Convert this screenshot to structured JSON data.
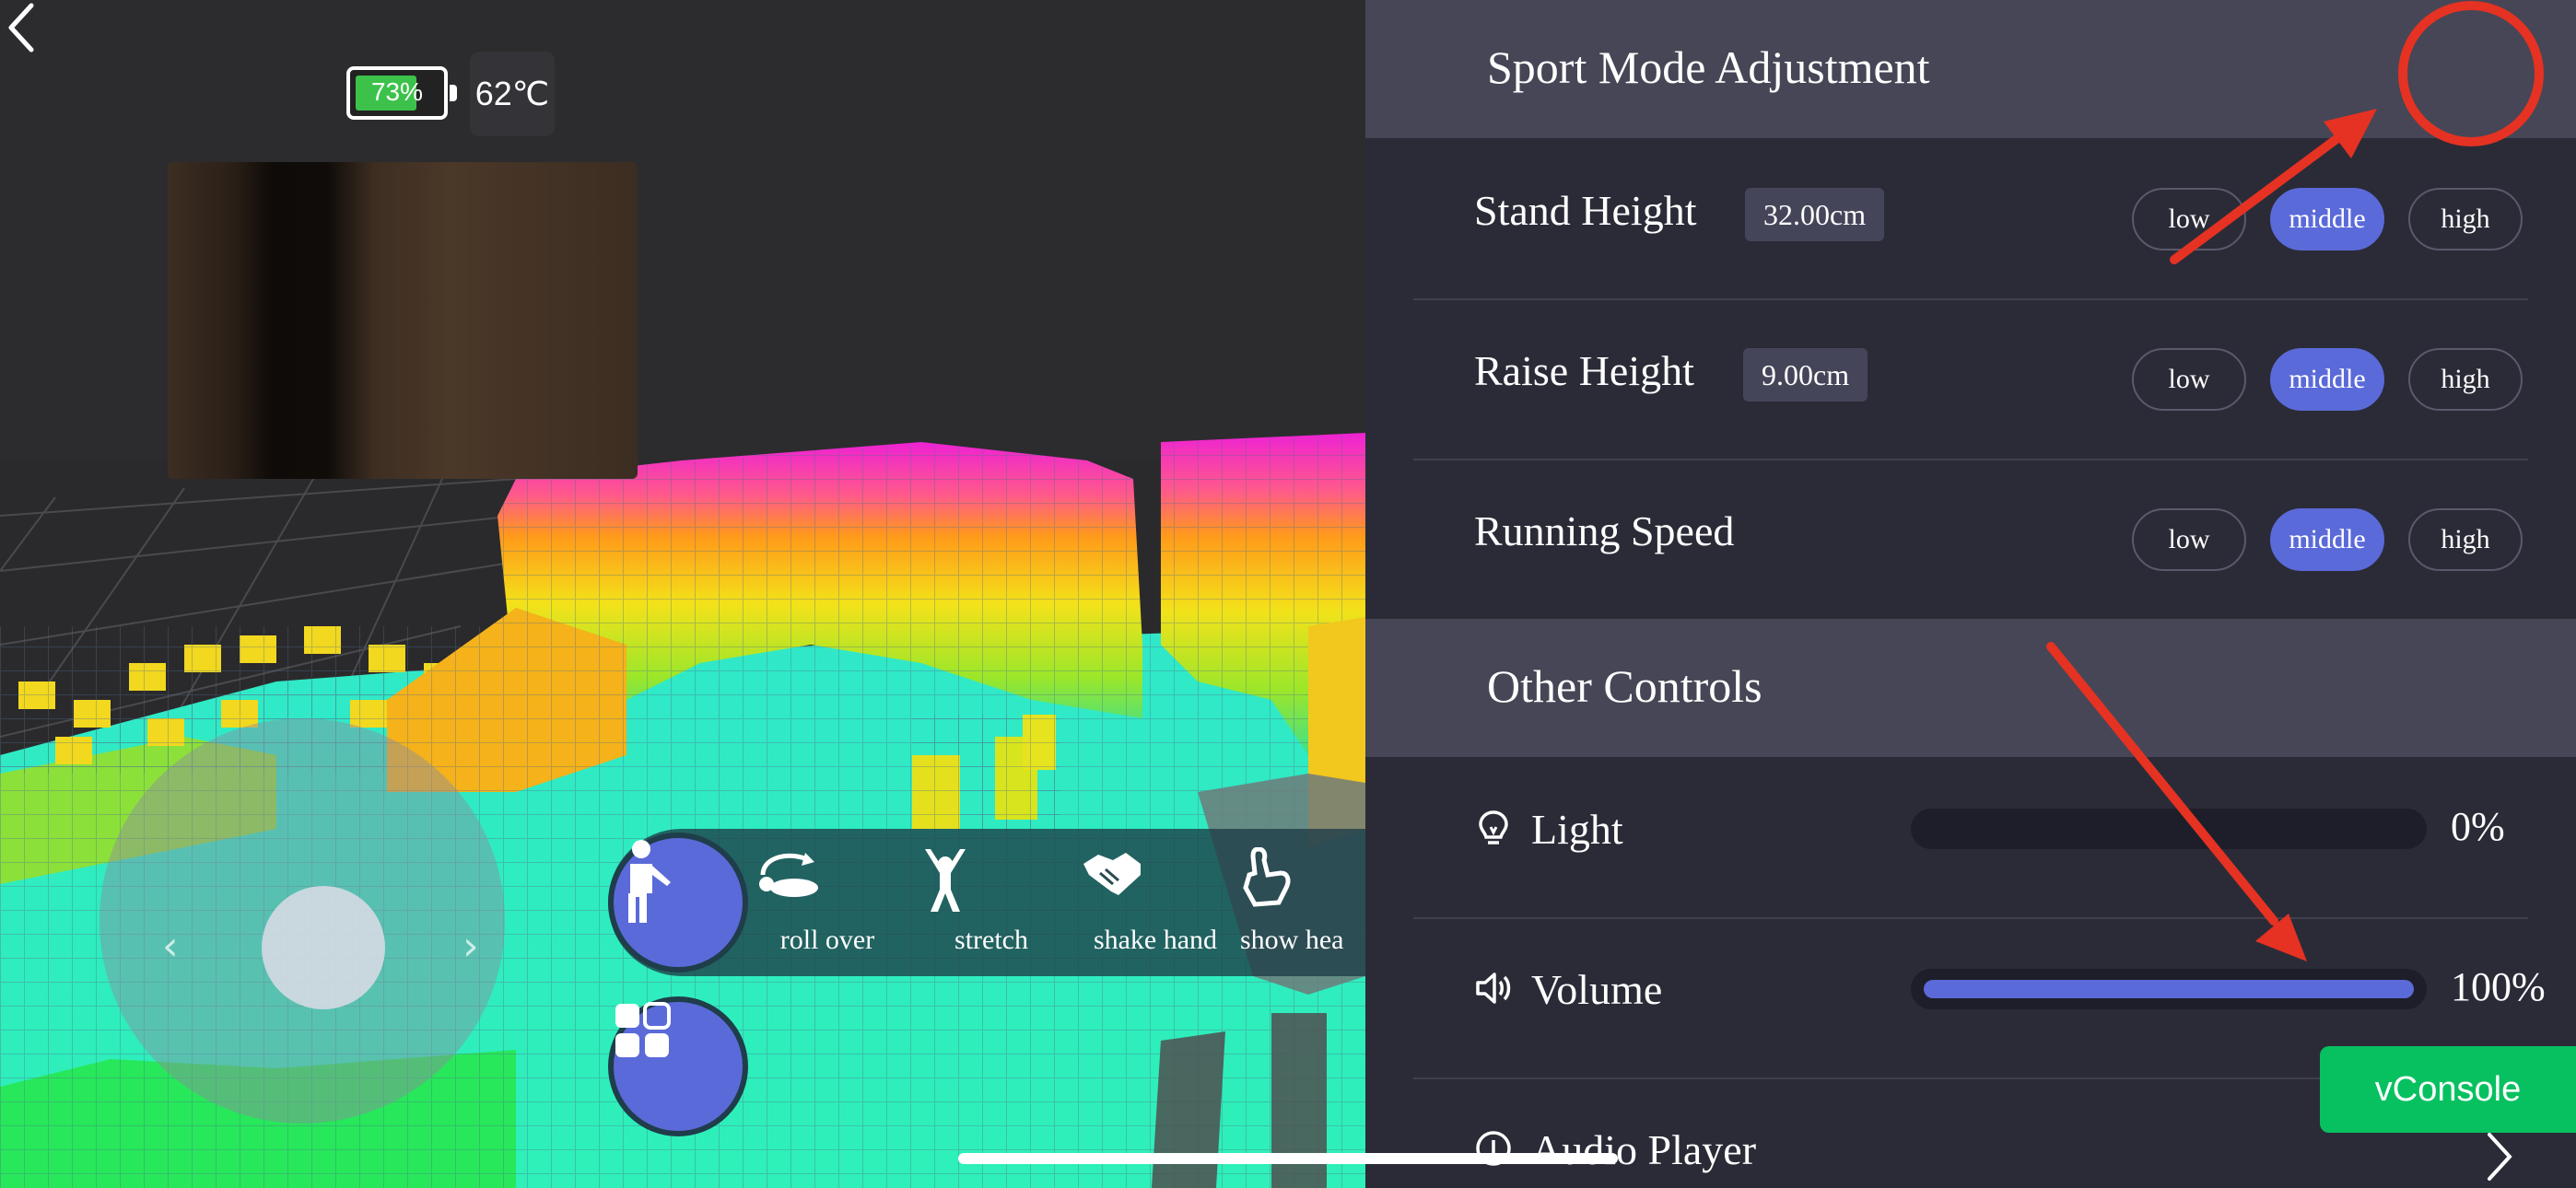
{
  "status": {
    "battery_percent": 73,
    "battery_label": "73%",
    "temperature": "62℃"
  },
  "actions": {
    "items": [
      {
        "label": "roll over",
        "icon": "roll-over-icon"
      },
      {
        "label": "stretch",
        "icon": "stretch-icon"
      },
      {
        "label": "shake hand",
        "icon": "shake-hand-icon"
      },
      {
        "label": "show hea",
        "icon": "heart-hand-icon"
      }
    ]
  },
  "sport_mode": {
    "title": "Sport Mode Adjustment",
    "rows": [
      {
        "name": "Stand Height",
        "value": "32.00cm",
        "options": [
          "low",
          "middle",
          "high"
        ],
        "selected": "middle"
      },
      {
        "name": "Raise Height",
        "value": "9.00cm",
        "options": [
          "low",
          "middle",
          "high"
        ],
        "selected": "middle"
      },
      {
        "name": "Running Speed",
        "value": "",
        "options": [
          "low",
          "middle",
          "high"
        ],
        "selected": "middle"
      }
    ]
  },
  "other_controls": {
    "title": "Other Controls",
    "light": {
      "name": "Light",
      "percent": 0,
      "label": "0%"
    },
    "volume": {
      "name": "Volume",
      "percent": 100,
      "label": "100%"
    },
    "audio_player": {
      "name": "Audio Player"
    }
  },
  "vconsole_label": "vConsole",
  "colors": {
    "accent": "#5b6ad9",
    "panel": "#2b2b38",
    "section": "#464656",
    "vconsole": "#07c160",
    "annotation": "#e53222"
  }
}
